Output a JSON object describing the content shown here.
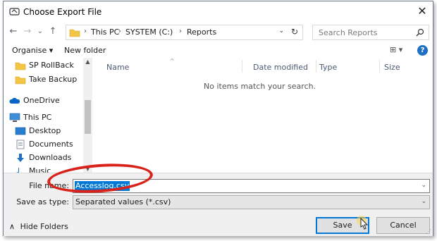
{
  "window": {
    "title": "Choose Export File",
    "close_symbol": "✕"
  },
  "nav": {
    "back": "←",
    "forward": "→",
    "recent": "⌄",
    "up": "↑",
    "breadcrumbs": [
      "This PC",
      "SYSTEM (C:)",
      "Reports"
    ],
    "separator": "›",
    "search_placeholder": "Search Reports"
  },
  "toolbar": {
    "organise_label": "Organise ▾",
    "new_folder_label": "New folder",
    "view_icon": "⊞ ▾",
    "help_label": "?"
  },
  "sidebar": {
    "items": [
      {
        "label": "SP RollBack",
        "icon": "folder-icon"
      },
      {
        "label": "Take Backup",
        "icon": "folder-icon"
      },
      {
        "label": "OneDrive",
        "icon": "cloud-icon"
      },
      {
        "label": "This PC",
        "icon": "computer-icon"
      },
      {
        "label": "Desktop",
        "icon": "desktop-icon"
      },
      {
        "label": "Documents",
        "icon": "document-icon"
      },
      {
        "label": "Downloads",
        "icon": "download-icon"
      },
      {
        "label": "Music",
        "icon": "music-icon"
      }
    ]
  },
  "filelist": {
    "columns": [
      "Name",
      "Date modified",
      "Type",
      "Size"
    ],
    "empty_message": "No items match your search."
  },
  "form": {
    "file_name_label": "File name:",
    "file_name_value": "Accesslog.csv",
    "save_type_label": "Save as type:",
    "save_type_value": "Separated values (*.csv)"
  },
  "footer": {
    "hide_folders_label": "Hide Folders",
    "save_label": "Save",
    "cancel_label": "Cancel"
  },
  "colors": {
    "accent": "#0078d7",
    "callout": "#d9221a",
    "folder": "#f3c545"
  }
}
